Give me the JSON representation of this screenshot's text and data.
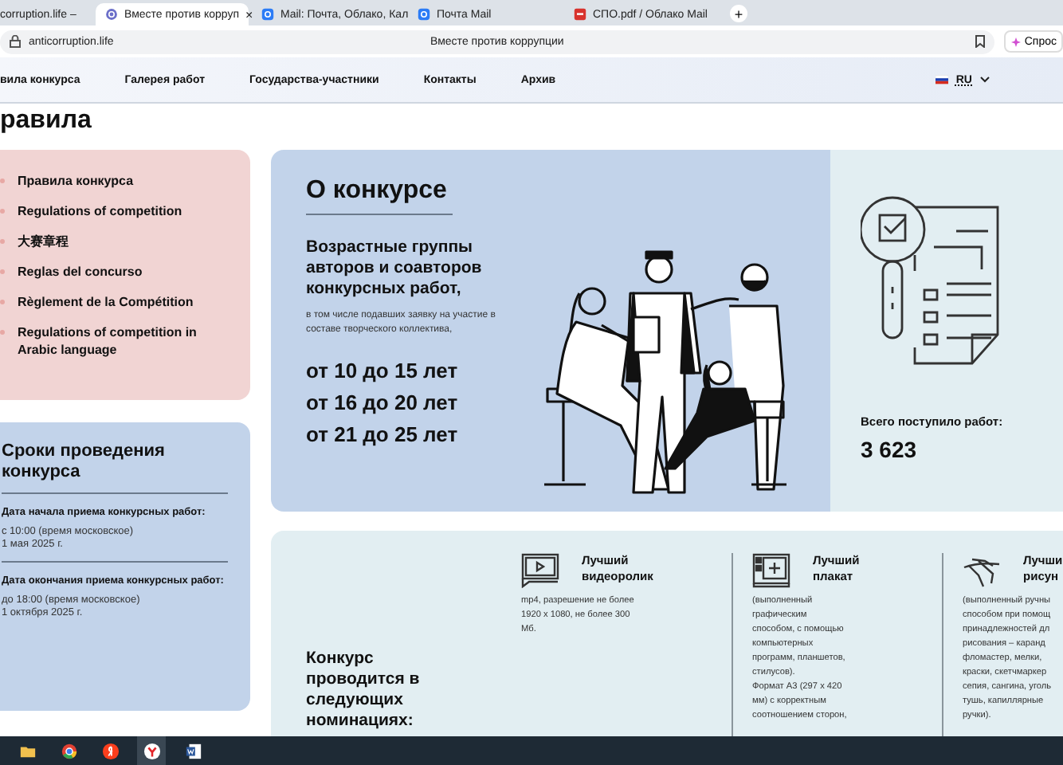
{
  "browser": {
    "tabs": [
      {
        "label": "corruption.life –",
        "kind": "plain",
        "selected": false
      },
      {
        "label": "Вместе против корруп",
        "kind": "site",
        "selected": true,
        "close": "×"
      },
      {
        "label": "Mail: Почта, Облако, Кал",
        "kind": "mail",
        "selected": false
      },
      {
        "label": "Почта Mail",
        "kind": "mail",
        "selected": false
      },
      {
        "label": "СПО.pdf / Облако Mail",
        "kind": "pdf",
        "selected": false
      }
    ],
    "new_tab": "+",
    "url": "anticorruption.life",
    "page_title": "Вместе против коррупции",
    "ask_button": "Спрос"
  },
  "nav": {
    "items": [
      "вила конкурса",
      "Галерея работ",
      "Государства-участники",
      "Контакты",
      "Архив"
    ],
    "language": "RU"
  },
  "heading": "равила",
  "rules_card": {
    "items": [
      "Правила конкурса",
      "Regulations of competition",
      "大赛章程",
      "Reglas del concurso",
      "Règlement de la Compétition",
      "Regulations of competition in Arabic language"
    ]
  },
  "dates_card": {
    "title": "Сроки проведения конкурса",
    "entries": [
      {
        "label": "Дата начала приема конкурсных работ:",
        "value": "с 10:00 (время московское)\n1 мая 2025 г."
      },
      {
        "label": "Дата окончания приема конкурсных работ:",
        "value": "до 18:00 (время московское)\n1 октября 2025 г."
      }
    ]
  },
  "about": {
    "title": "О конкурсе",
    "subtitle": "Возрастные группы авторов и соавторов конкурсных работ,",
    "note": "в том числе подавших заявку на участие в составе творческого коллектива,",
    "ages": [
      "от 10 до 15 лет",
      "от 16 до 20 лет",
      "от 21 до 25 лет"
    ],
    "total_label": "Всего поступило работ:",
    "total": "3 623"
  },
  "nominations": {
    "title": "Конкурс проводится в следующих номинациях:",
    "items": [
      {
        "kind": "video",
        "title": "Лучший\nвидеоролик",
        "description": "mp4, разрешение не более\n1920 x 1080, не более 300\nМб."
      },
      {
        "kind": "poster",
        "title": "Лучший\nплакат",
        "description": "(выполненный\nграфическим\nспособом, с помощью\nкомпьютерных\nпрограмм, планшетов,\nстилусов).\nФормат А3 (297 x 420\nмм) с корректным\nсоотношением сторон,"
      },
      {
        "kind": "drawing",
        "title": "Лучши\nрисун",
        "description": "(выполненный ручны\nспособом при помощ\nпринадлежностей дл\nрисования – каранд\nфломастер, мелки,\nкраски, скетчмаркер\nсепия, сангина, уголь\nтушь, капиллярные\nручки)."
      }
    ]
  },
  "taskbar": {
    "apps": [
      {
        "kind": "folder",
        "selected": false
      },
      {
        "kind": "chrome",
        "selected": false
      },
      {
        "kind": "letter",
        "selected": false
      },
      {
        "kind": "browser",
        "selected": true
      },
      {
        "kind": "document",
        "selected": false
      }
    ]
  }
}
